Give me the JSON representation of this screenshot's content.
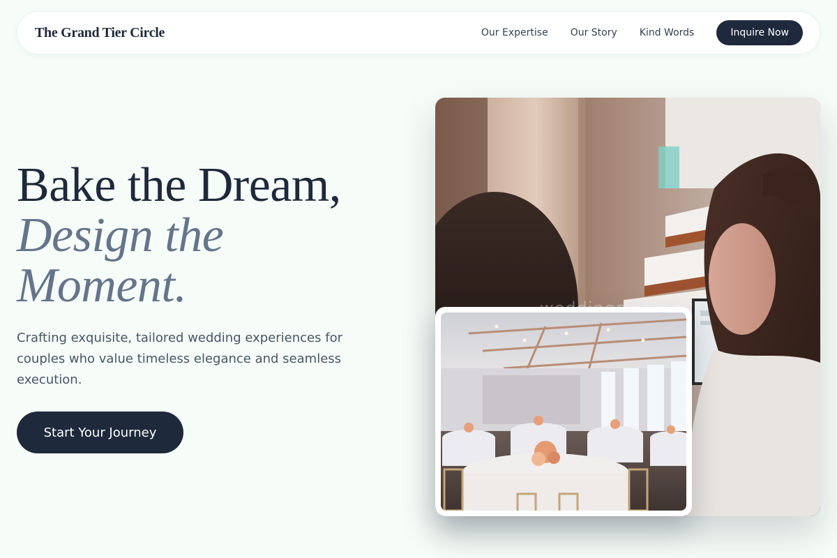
{
  "nav": {
    "brand": "The Grand Tier Circle",
    "links": [
      "Our Expertise",
      "Our Story",
      "Kind Words"
    ],
    "cta": "Inquire Now"
  },
  "hero": {
    "title_line1": "Bake the Dream,",
    "title_accent_line1": "Design the",
    "title_accent_line2": "Moment.",
    "subtitle": "Crafting exquisite, tailored wedding experiences for couples who value timeless elegance and seamless execution.",
    "cta": "Start Your Journey"
  },
  "images": {
    "main_photo_watermark": "weddingsintime"
  },
  "colors": {
    "background": "#f6fcf7",
    "primary": "#1e293b",
    "accent_text": "#64748b",
    "body_text": "#475569"
  }
}
